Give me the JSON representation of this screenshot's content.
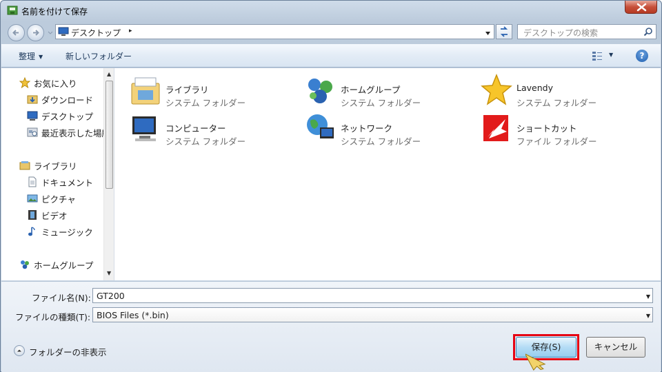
{
  "window": {
    "title": "名前を付けて保存"
  },
  "address": {
    "path": "デスクトップ",
    "separator": "▸"
  },
  "search": {
    "placeholder": "デスクトップの検索"
  },
  "toolbar": {
    "organize": "整理",
    "new_folder": "新しいフォルダー"
  },
  "nav_pane": {
    "favorites": {
      "label": "お気に入り",
      "items": [
        "ダウンロード",
        "デスクトップ",
        "最近表示した場所"
      ]
    },
    "libraries": {
      "label": "ライブラリ",
      "items": [
        "ドキュメント",
        "ピクチャ",
        "ビデオ",
        "ミュージック"
      ]
    },
    "homegroup": {
      "label": "ホームグループ"
    }
  },
  "items": [
    {
      "name": "ライブラリ",
      "type": "システム フォルダー",
      "icon": "library-icon"
    },
    {
      "name": "ホームグループ",
      "type": "システム フォルダー",
      "icon": "homegroup-icon"
    },
    {
      "name": "Lavendy",
      "type": "システム フォルダー",
      "icon": "star-icon"
    },
    {
      "name": "コンピューター",
      "type": "システム フォルダー",
      "icon": "computer-icon"
    },
    {
      "name": "ネットワーク",
      "type": "システム フォルダー",
      "icon": "network-icon"
    },
    {
      "name": "ショートカット",
      "type": "ファイル フォルダー",
      "icon": "shortcut-folder-icon"
    }
  ],
  "form": {
    "filename_label": "ファイル名(N):",
    "filename_value": "GT200",
    "filetype_label": "ファイルの種類(T):",
    "filetype_value": "BIOS Files (*.bin)"
  },
  "footer": {
    "hide_folders": "フォルダーの非表示",
    "save_button": "保存(S)",
    "cancel_button": "キャンセル"
  },
  "colors": {
    "highlight": "#e60012",
    "save_button": "#96cdef",
    "link_text": "#1e395b"
  }
}
